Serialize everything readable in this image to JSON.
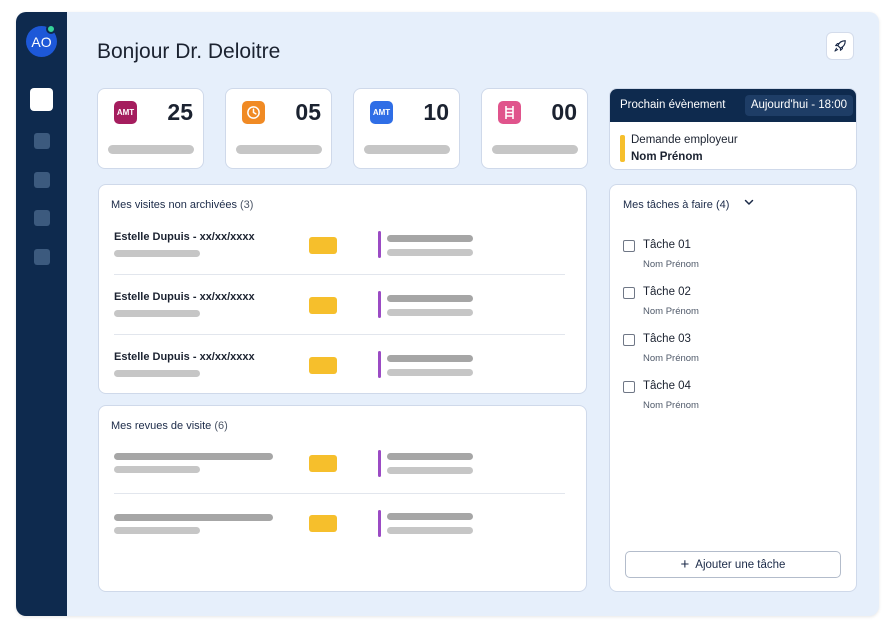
{
  "header": {
    "greeting": "Bonjour Dr. Deloitre",
    "rocket_icon": "rocket-icon"
  },
  "sidebar": {
    "avatar_initials": "AO",
    "status_color": "#35d39a",
    "items": [
      "nav-item-1",
      "nav-item-2",
      "nav-item-3",
      "nav-item-4",
      "nav-item-5"
    ]
  },
  "stats": [
    {
      "icon": "amt-icon",
      "icon_text": "AMT",
      "color": "#a51d5e",
      "value": "25"
    },
    {
      "icon": "clock-icon",
      "icon_text": "",
      "color": "#f08a24",
      "value": "05"
    },
    {
      "icon": "amt-icon",
      "icon_text": "AMT",
      "color": "#2f6ee6",
      "value": "10"
    },
    {
      "icon": "ladder-icon",
      "icon_text": "",
      "color": "#e0548c",
      "value": "00"
    }
  ],
  "next_event": {
    "title": "Prochain évènement",
    "time": "Aujourd'hui - 18:00",
    "type": "Demande employeur",
    "name": "Nom Prénom",
    "accent_color": "#f6bf2c"
  },
  "visits": {
    "title": "Mes visites non archivées",
    "count": "(3)",
    "rows": [
      {
        "name": "Estelle Dupuis - xx/xx/xxxx"
      },
      {
        "name": "Estelle Dupuis - xx/xx/xxxx"
      },
      {
        "name": "Estelle Dupuis - xx/xx/xxxx"
      }
    ]
  },
  "reviews": {
    "title": "Mes revues de visite",
    "count": "(6)"
  },
  "tasks": {
    "title": "Mes tâches à faire",
    "count": "(4)",
    "items": [
      {
        "name": "Tâche 01",
        "owner": "Nom Prénom"
      },
      {
        "name": "Tâche 02",
        "owner": "Nom Prénom"
      },
      {
        "name": "Tâche 03",
        "owner": "Nom Prénom"
      },
      {
        "name": "Tâche 04",
        "owner": "Nom Prénom"
      }
    ],
    "add_label": "Ajouter une tâche"
  },
  "colors": {
    "navy": "#0e2a4e",
    "background": "#e6effb",
    "chip_yellow": "#f6bf2c",
    "accent_purple": "#9b4bc4"
  }
}
